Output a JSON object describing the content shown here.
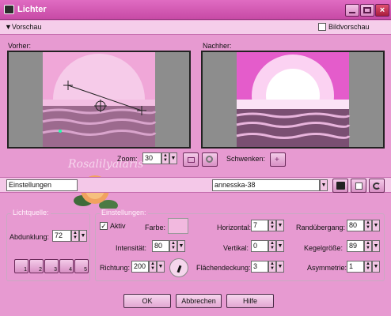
{
  "window": {
    "title": "Lichter"
  },
  "header": {
    "preview_toggle": "Vorschau",
    "image_preview_label": "Bildvorschau"
  },
  "previews": {
    "before_label": "Vorher:",
    "after_label": "Nachher:"
  },
  "zoom": {
    "label": "Zoom:",
    "value": "30"
  },
  "pan": {
    "label": "Schwenken:"
  },
  "settings": {
    "label": "Einstellungen",
    "preset_value": "annesska-38"
  },
  "watermark": {
    "text": "Rosalilyalaris"
  },
  "lightsource": {
    "group_label": "Lichtquelle:",
    "darkening_label": "Abdunklung:",
    "darkening_value": "72",
    "light_buttons": [
      "1",
      "2",
      "3",
      "4",
      "5"
    ]
  },
  "einstellungen": {
    "group_label": "Einstellungen:",
    "active_label": "Aktiv",
    "color_label": "Farbe:",
    "color_value": "#f2b9df",
    "intensity_label": "Intensität:",
    "intensity_value": "80",
    "direction_label": "Richtung:",
    "direction_value": "200",
    "horizontal_label": "Horizontal:",
    "horizontal_value": "7",
    "vertical_label": "Vertikal:",
    "vertical_value": "0",
    "coverage_label": "Flächendeckung:",
    "coverage_value": "3",
    "edge_label": "Randübergang:",
    "edge_value": "80",
    "cone_label": "Kegelgröße:",
    "cone_value": "89",
    "asym_label": "Asymmetrie:",
    "asym_value": "1"
  },
  "buttons": {
    "ok": "OK",
    "cancel": "Abbrechen",
    "help": "Hilfe"
  }
}
